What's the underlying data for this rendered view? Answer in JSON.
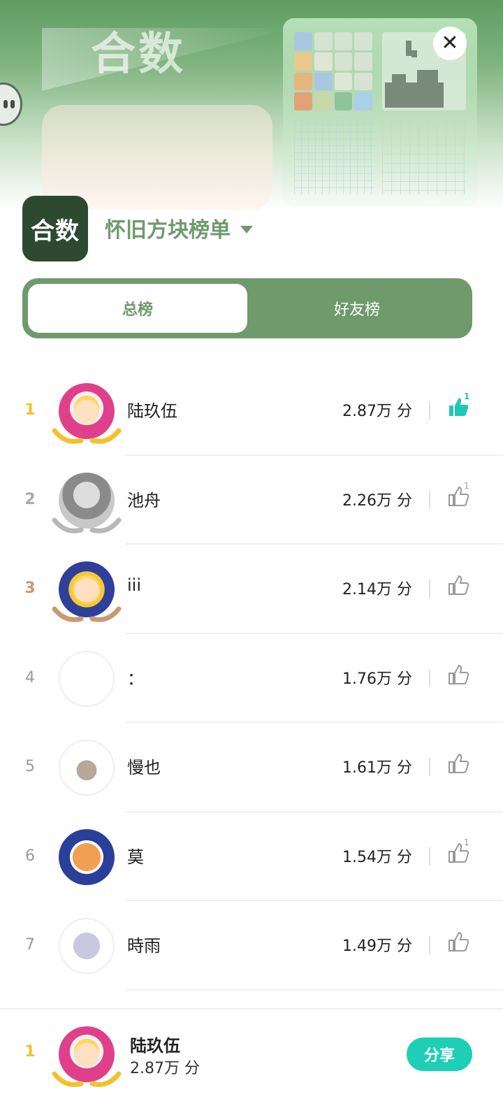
{
  "header": {
    "banner_title": "合数",
    "close_icon": "close-icon",
    "colors": {
      "top": "#5e9c61",
      "accent": "#6f9a6c",
      "share": "#1ecfb6"
    }
  },
  "game": {
    "icon_text": "合数",
    "board_title": "怀旧方块榜单"
  },
  "tabs": [
    {
      "label": "总榜",
      "active": true
    },
    {
      "label": "好友榜",
      "active": false
    }
  ],
  "leaderboard": [
    {
      "rank": "1",
      "name": "陆玖伍",
      "score": "2.87万 分",
      "likes": "1",
      "liked": true
    },
    {
      "rank": "2",
      "name": "池舟",
      "score": "2.26万 分",
      "likes": "1",
      "liked": false
    },
    {
      "rank": "3",
      "name": "iii",
      "score": "2.14万 分",
      "likes": "",
      "liked": false
    },
    {
      "rank": "4",
      "name": "：",
      "score": "1.76万 分",
      "likes": "",
      "liked": false
    },
    {
      "rank": "5",
      "name": "慢也",
      "score": "1.61万 分",
      "likes": "",
      "liked": false
    },
    {
      "rank": "6",
      "name": "莫",
      "score": "1.54万 分",
      "likes": "1",
      "liked": false
    },
    {
      "rank": "7",
      "name": "時雨",
      "score": "1.49万 分",
      "likes": "",
      "liked": false
    }
  ],
  "me": {
    "rank": "1",
    "name": "陆玖伍",
    "score": "2.87万 分",
    "share_label": "分享"
  }
}
